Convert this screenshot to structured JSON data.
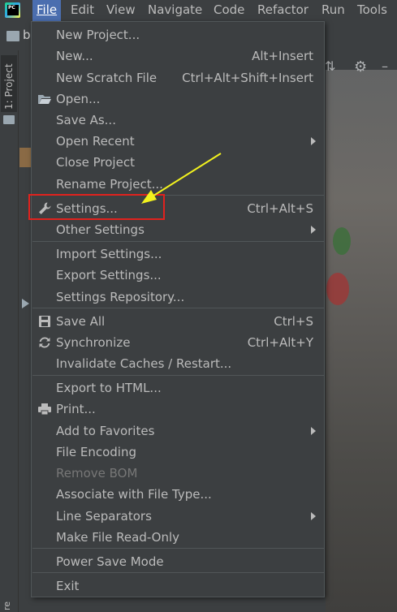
{
  "app": {
    "logo_text": "PC"
  },
  "menubar": [
    {
      "key": "file",
      "label": "File"
    },
    {
      "key": "edit",
      "label": "Edit"
    },
    {
      "key": "view",
      "label": "View"
    },
    {
      "key": "navigate",
      "label": "Navigate"
    },
    {
      "key": "code",
      "label": "Code"
    },
    {
      "key": "refactor",
      "label": "Refactor"
    },
    {
      "key": "run",
      "label": "Run"
    },
    {
      "key": "tools",
      "label": "Tools"
    }
  ],
  "background": {
    "nav_fragment": "b",
    "project_tab_label": "1: Project",
    "bottom_tab_fragment": "re"
  },
  "file_menu": {
    "new_project": {
      "label": "New Project..."
    },
    "new": {
      "label": "New...",
      "shortcut": "Alt+Insert"
    },
    "new_scratch": {
      "label": "New Scratch File",
      "shortcut": "Ctrl+Alt+Shift+Insert"
    },
    "open": {
      "label": "Open...",
      "icon": "folder-open-icon"
    },
    "save_as": {
      "label": "Save As..."
    },
    "open_recent": {
      "label": "Open Recent"
    },
    "close_project": {
      "label": "Close Project"
    },
    "rename_project": {
      "label": "Rename Project..."
    },
    "settings": {
      "label": "Settings...",
      "shortcut": "Ctrl+Alt+S",
      "icon": "wrench-icon"
    },
    "other_settings": {
      "label": "Other Settings"
    },
    "import_settings": {
      "label": "Import Settings..."
    },
    "export_settings": {
      "label": "Export Settings..."
    },
    "settings_repository": {
      "label": "Settings Repository..."
    },
    "save_all": {
      "label": "Save All",
      "shortcut": "Ctrl+S",
      "icon": "save-icon"
    },
    "synchronize": {
      "label": "Synchronize",
      "shortcut": "Ctrl+Alt+Y",
      "icon": "sync-icon"
    },
    "invalidate_caches": {
      "label": "Invalidate Caches / Restart..."
    },
    "export_html": {
      "label": "Export to HTML..."
    },
    "print": {
      "label": "Print...",
      "icon": "printer-icon"
    },
    "add_favorites": {
      "label": "Add to Favorites"
    },
    "file_encoding": {
      "label": "File Encoding"
    },
    "remove_bom": {
      "label": "Remove BOM"
    },
    "associate_file_type": {
      "label": "Associate with File Type..."
    },
    "line_separators": {
      "label": "Line Separators"
    },
    "make_read_only": {
      "label": "Make File Read-Only"
    },
    "power_save": {
      "label": "Power Save Mode"
    },
    "exit": {
      "label": "Exit"
    }
  },
  "colors": {
    "menu_bg": "#3c3f41",
    "active_menu": "#4b6eaf",
    "highlight_box": "#e0221e",
    "arrow": "#f2f21e"
  }
}
